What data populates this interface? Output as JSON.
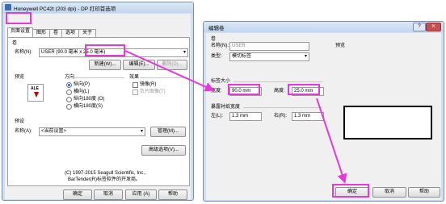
{
  "left_window": {
    "title": "Honeywell PC42t (203 dpi) - DP 打印首选项",
    "tabs": [
      "页面设置",
      "图形",
      "卷",
      "选项",
      "关于"
    ],
    "volume_section": "卷",
    "name_label": "名称(N):",
    "name_value": "USER (90.0 毫米 x 25.0 毫米)",
    "new_button": "新建(W)...",
    "edit_button": "编辑(E)...",
    "delete_button": "删除(D)...",
    "preview_label": "预览",
    "preview_icon_text": "ALE",
    "orientation_label": "方向",
    "orientation_options": [
      "纵向(P)",
      "横向(L)",
      "纵向180度 (O)",
      "横向180度(S)"
    ],
    "effects_label": "效果",
    "effects_options": [
      "镜像(R)",
      "负片图像(T)"
    ],
    "preset_label": "预设",
    "preset_name_label": "名称(A):",
    "preset_value": "<当前设置>",
    "manage_button": "管理(M)...",
    "advanced_button": "高级选项(V)...",
    "copyright_line1": "(C) 1997-2015 Seagull Scientific, Inc.,",
    "copyright_line2": "BarTender(R)标签软件的开发商。",
    "ok_button": "确定",
    "cancel_button": "取消",
    "apply_button": "应用 (A)",
    "help_button": "帮助"
  },
  "right_window": {
    "title": "编辑卷",
    "volume_section": "卷",
    "name_label": "名称(N):",
    "name_value": "USER",
    "type_label": "类型:",
    "type_value": "模切标签",
    "preview_label": "预览",
    "label_size_label": "标签大小",
    "width_label": "宽度:",
    "width_value": "90.0 mm",
    "height_label": "高度:",
    "height_value": "25.0 mm",
    "liner_label": "暴露衬纸宽度",
    "left_label": "左(L):",
    "left_value": "1.3 mm",
    "right_label": "右(R):",
    "right_value": "1.3 mm",
    "ok_button": "确定",
    "cancel_button": "取消",
    "help_button": "帮助"
  },
  "annotation_color": "#e63ad8"
}
